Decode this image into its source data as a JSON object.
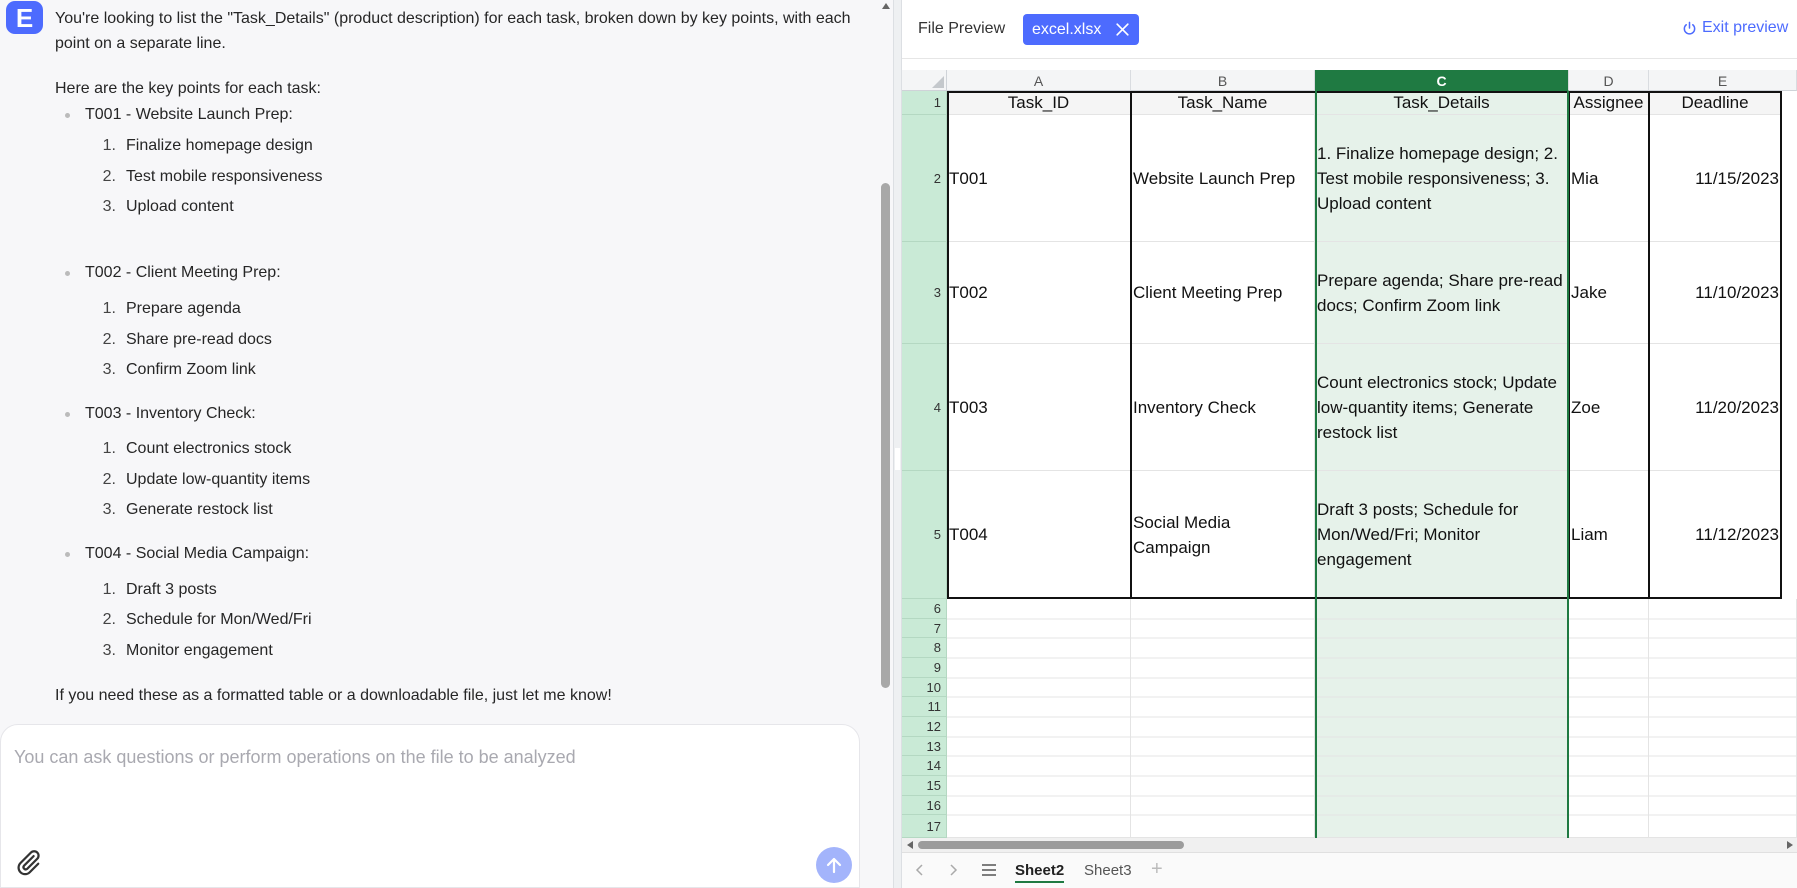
{
  "chat": {
    "logo_letter": "E",
    "intro": "You're looking to list the \"Task_Details\" (product description) for each task, broken down by key points, with each point on a separate line.",
    "keypoints_heading": "Here are the key points for each task:",
    "tasks": [
      {
        "heading": "T001 - Website Launch Prep:",
        "points": [
          "Finalize homepage design",
          "Test mobile responsiveness",
          "Upload content"
        ]
      },
      {
        "heading": "T002 - Client Meeting Prep:",
        "points": [
          "Prepare agenda",
          "Share pre-read docs",
          "Confirm Zoom link"
        ]
      },
      {
        "heading": "T003 - Inventory Check:",
        "points": [
          "Count electronics stock",
          "Update low-quantity items",
          "Generate restock list"
        ]
      },
      {
        "heading": "T004 - Social Media Campaign:",
        "points": [
          "Draft 3 posts",
          "Schedule for Mon/Wed/Fri",
          "Monitor engagement"
        ]
      }
    ],
    "point_numbers": [
      "1.",
      "2.",
      "3."
    ],
    "closing": "If you need these as a formatted table or a downloadable file, just let me know!",
    "input_placeholder": "You can ask questions or perform operations on the file to be analyzed"
  },
  "preview": {
    "title": "File Preview",
    "file_tab": "excel.xlsx",
    "exit_label": "Exit preview"
  },
  "sheet": {
    "selected_column": "C",
    "columns": [
      "A",
      "B",
      "C",
      "D",
      "E"
    ],
    "row_numbers": [
      "1",
      "2",
      "3",
      "4",
      "5",
      "6",
      "7",
      "8",
      "9",
      "10",
      "11",
      "12",
      "13",
      "14",
      "15",
      "16",
      "17"
    ],
    "headers": [
      "Task_ID",
      "Task_Name",
      "Task_Details",
      "Assignee",
      "Deadline"
    ],
    "rows": [
      [
        "T001",
        "Website Launch Prep",
        "1. Finalize homepage design; 2. Test mobile responsiveness; 3. Upload content",
        "Mia",
        "11/15/2023"
      ],
      [
        "T002",
        "Client Meeting Prep",
        "Prepare agenda; Share pre-read docs; Confirm Zoom link",
        "Jake",
        "11/10/2023"
      ],
      [
        "T003",
        "Inventory Check",
        "Count electronics stock; Update low-quantity items; Generate restock list",
        "Zoe",
        "11/20/2023"
      ],
      [
        "T004",
        "Social Media Campaign",
        "Draft 3 posts; Schedule for Mon/Wed/Fri; Monitor engagement",
        "Liam",
        "11/12/2023"
      ]
    ],
    "tabs": [
      "Sheet2",
      "Sheet3"
    ],
    "active_tab": "Sheet2",
    "add_tab_label": "+"
  },
  "colors": {
    "accent": "#4d6bfe",
    "sheet_selection": "#1f7a42",
    "selection_fill": "#e6f2ea",
    "row_header_fill": "#c9ead6"
  }
}
